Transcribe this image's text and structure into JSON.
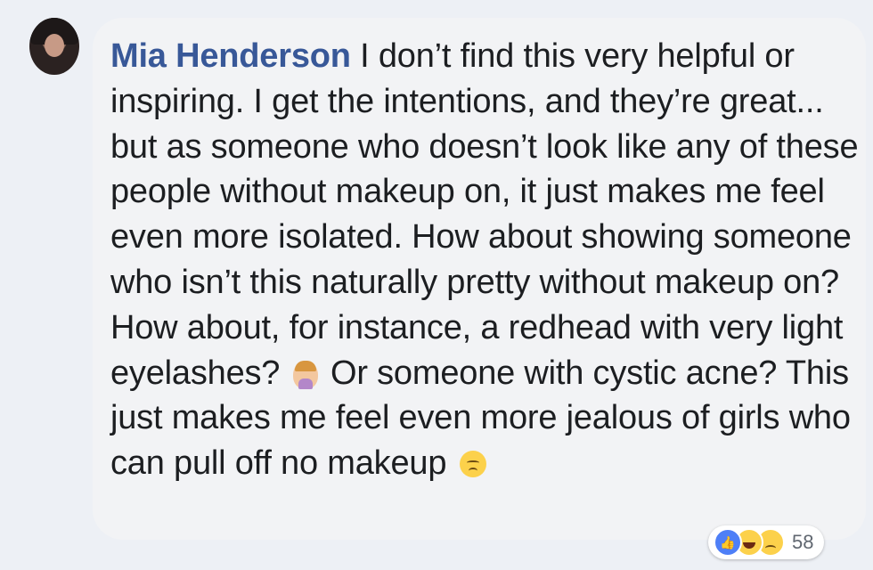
{
  "comment": {
    "author": "Mia Henderson",
    "text_part1": " I don’t find this very helpful or inspiring. I get the intentions, and they’re great... but as someone who doesn’t look like any of these people without makeup on, it just makes me feel even more isolated. How about showing someone who isn’t this naturally pretty without makeup on? How about, for instance, a redhead with very light eyelashes? ",
    "emoji1": "person-raising-hand-emoji",
    "text_part2": " Or someone with cystic acne? This just makes me feel even more jealous of girls who can pull off no makeup ",
    "emoji2": "disappointed-face-emoji"
  },
  "reactions": {
    "icons": [
      "like-icon",
      "haha-icon",
      "sad-icon"
    ],
    "count": "58",
    "colors": {
      "like": "#4e7ff7",
      "haha": "#fcd14b",
      "sad": "#fcd14b"
    }
  },
  "colors": {
    "author": "#385898",
    "bubble": "#f2f3f5",
    "text": "#1c1e21",
    "background": "#edf0f5"
  }
}
